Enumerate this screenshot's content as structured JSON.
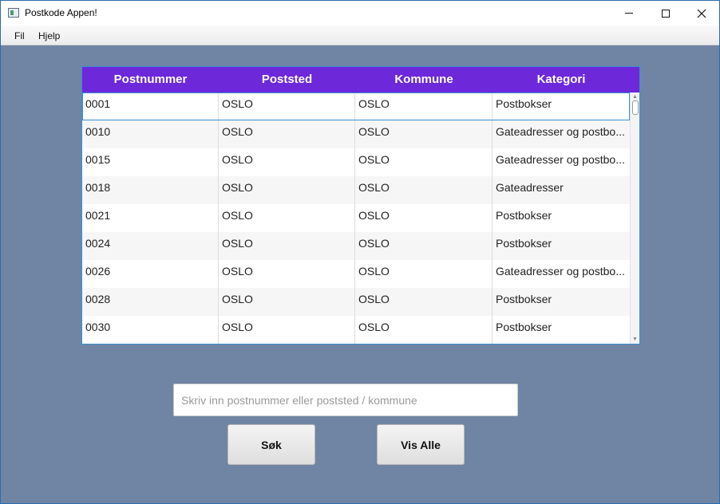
{
  "window": {
    "title": "Postkode Appen!",
    "icon": "app-window-icon"
  },
  "menu": {
    "items": [
      "Fil",
      "Hjelp"
    ]
  },
  "table": {
    "headers": [
      "Postnummer",
      "Poststed",
      "Kommune",
      "Kategori"
    ],
    "header_color": "#6d28d9",
    "selected_row": 0,
    "rows": [
      [
        "0001",
        "OSLO",
        "OSLO",
        "Postbokser"
      ],
      [
        "0010",
        "OSLO",
        "OSLO",
        "Gateadresser og postbo..."
      ],
      [
        "0015",
        "OSLO",
        "OSLO",
        "Gateadresser og postbo..."
      ],
      [
        "0018",
        "OSLO",
        "OSLO",
        "Gateadresser"
      ],
      [
        "0021",
        "OSLO",
        "OSLO",
        "Postbokser"
      ],
      [
        "0024",
        "OSLO",
        "OSLO",
        "Postbokser"
      ],
      [
        "0026",
        "OSLO",
        "OSLO",
        "Gateadresser og postbo..."
      ],
      [
        "0028",
        "OSLO",
        "OSLO",
        "Postbokser"
      ],
      [
        "0030",
        "OSLO",
        "OSLO",
        "Postbokser"
      ]
    ]
  },
  "search": {
    "placeholder": "Skriv inn postnummer eller poststed / kommune",
    "value": ""
  },
  "buttons": {
    "search_label": "Søk",
    "show_all_label": "Vis Alle"
  },
  "colors": {
    "background": "#6f85a3",
    "accent_border": "#3a8fd8"
  }
}
